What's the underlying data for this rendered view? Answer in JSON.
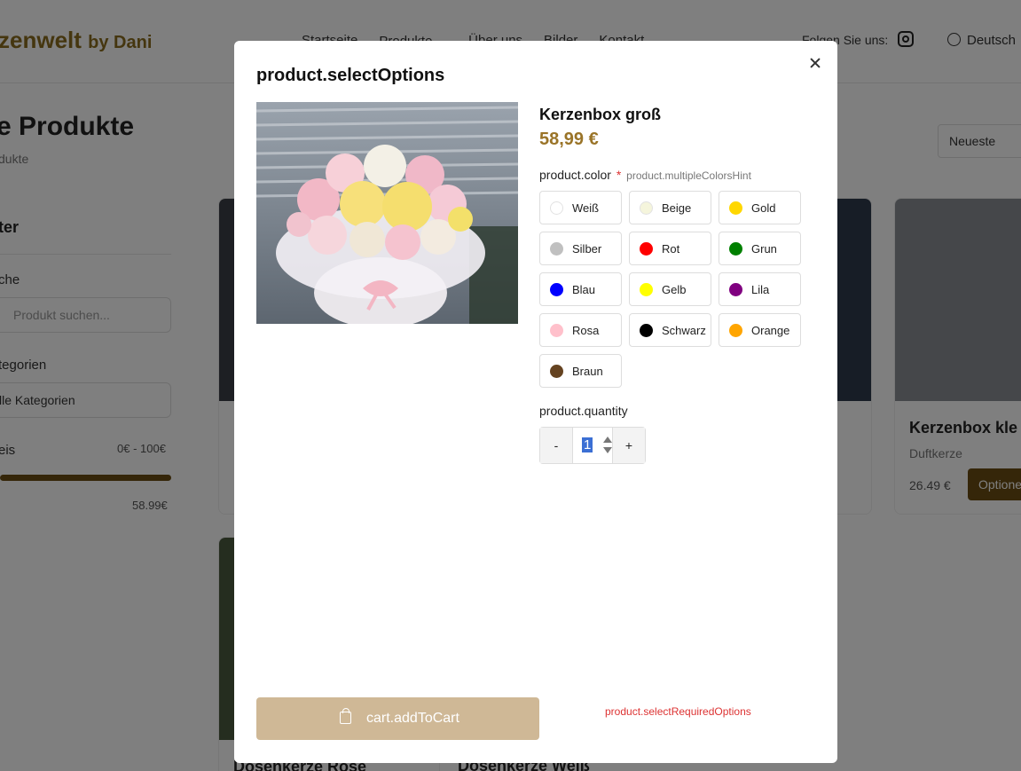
{
  "background": {
    "logo": {
      "main": "zenwelt",
      "suffix": "by Dani"
    },
    "nav": [
      "Startseite",
      "Produkte",
      "Über uns",
      "Bilder",
      "Kontakt"
    ],
    "follow_text": "Folgen Sie uns:",
    "language": "Deutsch",
    "page_title": "e Produkte",
    "page_subtitle": "dukte",
    "sort_value": "Neueste",
    "filter": {
      "title": "ter",
      "search_label": "che",
      "search_placeholder": "Produkt suchen...",
      "categories_label": "tegorien",
      "categories_value": "lle Kategorien",
      "price_label": "eis",
      "price_range": "0€ - 100€",
      "price_max": "58.99€"
    },
    "cards": [
      {
        "title": "Kerzenbox kle",
        "category": "Duftkerze",
        "price": "26.49 €",
        "button": "Optione"
      },
      {
        "title": "Dosenkerze Rose"
      },
      {
        "title": "Dosenkerze Weiß"
      }
    ]
  },
  "modal": {
    "title": "product.selectOptions",
    "product_name": "Kerzenbox groß",
    "price": "58,99 €",
    "color_label": "product.color",
    "required_mark": "*",
    "color_hint": "product.multipleColorsHint",
    "colors": [
      {
        "name": "Weiß",
        "hex": "#ffffff"
      },
      {
        "name": "Beige",
        "hex": "#f5f5dc"
      },
      {
        "name": "Gold",
        "hex": "#ffd700"
      },
      {
        "name": "Silber",
        "hex": "#c0c0c0"
      },
      {
        "name": "Rot",
        "hex": "#ff0000"
      },
      {
        "name": "Grun",
        "hex": "#008000"
      },
      {
        "name": "Blau",
        "hex": "#0000ff"
      },
      {
        "name": "Gelb",
        "hex": "#ffff00"
      },
      {
        "name": "Lila",
        "hex": "#800080"
      },
      {
        "name": "Rosa",
        "hex": "#ffc0cb"
      },
      {
        "name": "Schwarz",
        "hex": "#000000"
      },
      {
        "name": "Orange",
        "hex": "#ffa500"
      },
      {
        "name": "Braun",
        "hex": "#654321"
      }
    ],
    "quantity_label": "product.quantity",
    "quantity_value": "1",
    "decrement": "-",
    "increment": "+",
    "add_to_cart": "cart.addToCart",
    "required_message": "product.selectRequiredOptions"
  }
}
